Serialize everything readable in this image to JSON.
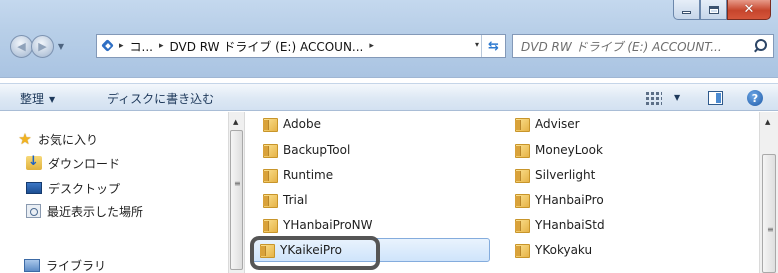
{
  "window": {
    "caption_buttons": [
      {
        "name": "minimize",
        "icon": "minimize-icon"
      },
      {
        "name": "maximize",
        "icon": "maximize-icon"
      },
      {
        "name": "close",
        "icon": "close-icon",
        "glyph": "✕"
      }
    ]
  },
  "nav": {
    "back_icon": "back-arrow-icon",
    "forward_icon": "forward-arrow-icon",
    "history_dropdown_icon": "chevron-down-icon"
  },
  "address": {
    "location_icon": "drive-icon",
    "crumbs": [
      "コ...",
      "DVD RW ドライブ (E:) ACCOUN..."
    ],
    "separator": "▸",
    "dropdown_glyph": "▾",
    "refresh_glyph": "⇆"
  },
  "search": {
    "placeholder": "DVD RW ドライブ (E:) ACCOUNT..."
  },
  "commandbar": {
    "organize": "整理",
    "burn": "ディスクに書き込む",
    "view_icon": "view-options-icon",
    "preview_pane_icon": "preview-pane-icon",
    "help_glyph": "?"
  },
  "navpane": {
    "favorites": "お気に入り",
    "downloads": "ダウンロード",
    "desktop": "デスクトップ",
    "recent": "最近表示した場所",
    "libraries": "ライブラリ"
  },
  "files": {
    "col1": [
      "Adobe",
      "BackupTool",
      "Runtime",
      "Trial",
      "YHanbaiProNW",
      "YKaikeiPro"
    ],
    "col2": [
      "Adviser",
      "MoneyLook",
      "Silverlight",
      "YHanbaiPro",
      "YHanbaiStd",
      "YKokyaku"
    ],
    "selected": "YKaikeiPro"
  },
  "colors": {
    "accent": "#1e395b",
    "selection": "#cfe4fb",
    "folder": "#e6b347"
  }
}
